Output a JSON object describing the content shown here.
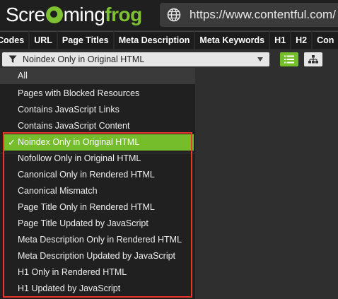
{
  "app": {
    "logo": {
      "part1": "Scre",
      "part2": "ming",
      "part3": "frog"
    },
    "url": "https://www.contentful.com/"
  },
  "tabs": [
    "Codes",
    "URL",
    "Page Titles",
    "Meta Description",
    "Meta Keywords",
    "H1",
    "H2",
    "Con"
  ],
  "filter": {
    "selected_label": "Noindex Only in Original HTML",
    "options": [
      {
        "label": "All"
      },
      {
        "label": "Pages with Blocked Resources"
      },
      {
        "label": "Contains JavaScript Links"
      },
      {
        "label": "Contains JavaScript Content"
      },
      {
        "label": "Noindex Only in Original HTML",
        "checked": true
      },
      {
        "label": "Nofollow Only in Original HTML"
      },
      {
        "label": "Canonical Only in Rendered HTML"
      },
      {
        "label": "Canonical Mismatch"
      },
      {
        "label": "Page Title Only in Rendered HTML"
      },
      {
        "label": "Page Title Updated by JavaScript"
      },
      {
        "label": "Meta Description Only in Rendered HTML"
      },
      {
        "label": "Meta Description Updated by JavaScript"
      },
      {
        "label": "H1 Only in Rendered HTML"
      },
      {
        "label": "H1 Updated by JavaScript"
      }
    ],
    "check_mark": "✓"
  },
  "colors": {
    "accent_green": "#76bd2c",
    "highlight_red": "#e8382b",
    "dropdown_bg": "#202020",
    "header_bg": "#1f1f1f"
  },
  "icons": {
    "url_bar": "globe-icon",
    "filter": "funnel-icon",
    "dropdown": "caret-down-icon",
    "view_list": "list-view-icon",
    "view_tree": "tree-view-icon"
  }
}
